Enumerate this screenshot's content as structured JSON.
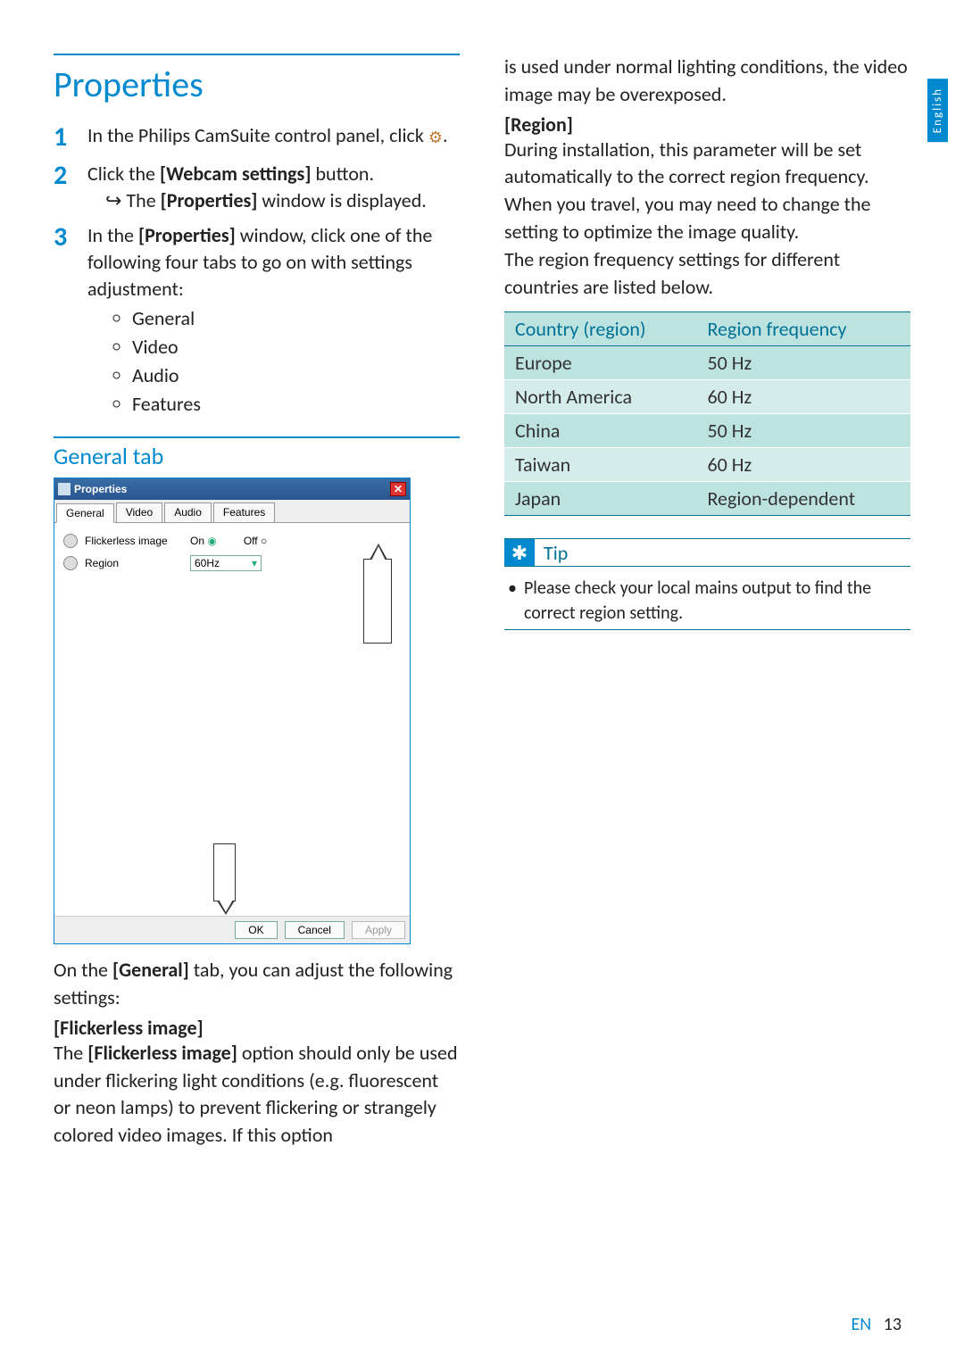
{
  "section": {
    "title": "Properties",
    "general_tab_title": "General tab"
  },
  "steps": {
    "s1_pre": "In the Philips CamSuite control panel, click ",
    "s1_post": ".",
    "s2_text": "Click the ",
    "s2_bold": "[Webcam settings]",
    "s2_end": " button.",
    "s2_result_pre": "The ",
    "s2_result_bold": "[Properties]",
    "s2_result_end": " window is displayed.",
    "s3_pre": "In the ",
    "s3_bold": "[Properties]",
    "s3_end": " window, click one of the following four tabs to go on with settings adjustment:",
    "s3_items": [
      "General",
      "Video",
      "Audio",
      "Features"
    ]
  },
  "prop_window": {
    "title": "Properties",
    "tabs": [
      "General",
      "Video",
      "Audio",
      "Features"
    ],
    "row1_label": "Flickerless image",
    "row1_on": "On",
    "row1_off": "Off",
    "row2_label": "Region",
    "row2_value": "60Hz",
    "buttons": {
      "ok": "OK",
      "cancel": "Cancel",
      "apply": "Apply"
    }
  },
  "general_para": {
    "intro_pre": "On the ",
    "intro_bold": "[General]",
    "intro_end": " tab, you can adjust the following settings:",
    "flicker_heading": "[Flickerless image]",
    "flicker_pre": "The ",
    "flicker_bold": "[Flickerless image]",
    "flicker_body": " option should only be used under flickering light conditions (e.g. fluorescent or neon lamps) to prevent flickering or strangely colored video images. If this option"
  },
  "col2": {
    "cont": "is used under normal lighting conditions, the video image may be overexposed.",
    "region_heading": "[Region]",
    "region_body": "During installation, this parameter will be set automatically to the correct region frequency. When you travel, you may need to change the setting to optimize the image quality.",
    "region_body2": "The region frequency settings for different countries are listed below."
  },
  "table": {
    "h1": "Country (region)",
    "h2": "Region frequency",
    "rows": [
      {
        "c": "Europe",
        "f": "50 Hz"
      },
      {
        "c": "North America",
        "f": "60 Hz"
      },
      {
        "c": "China",
        "f": "50 Hz"
      },
      {
        "c": "Taiwan",
        "f": "60 Hz"
      },
      {
        "c": "Japan",
        "f": "Region-dependent"
      }
    ]
  },
  "tip": {
    "label": "Tip",
    "text": "Please check your local mains output to find the correct region setting."
  },
  "side_tab": "English",
  "footer": {
    "lang": "EN",
    "page": "13"
  }
}
